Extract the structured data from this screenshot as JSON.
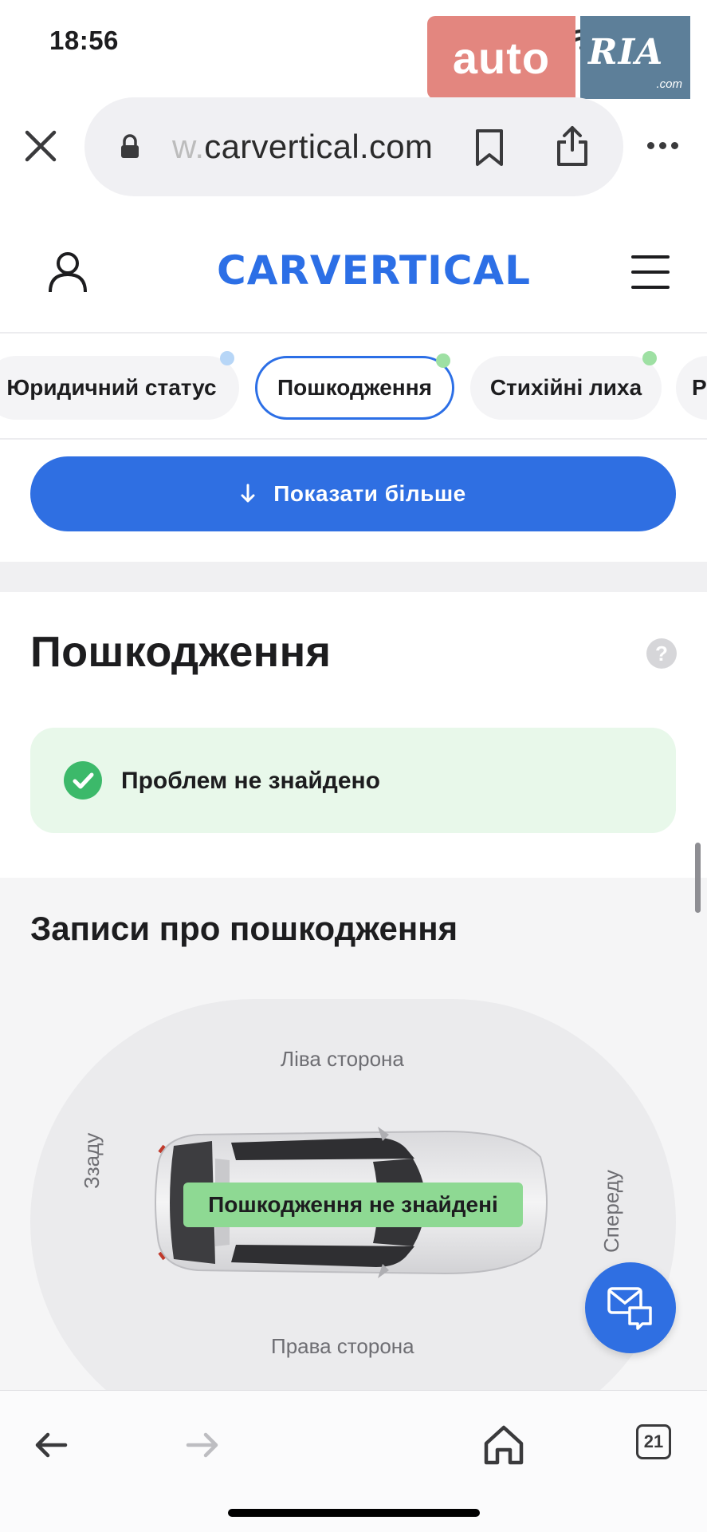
{
  "status": {
    "time": "18:56"
  },
  "watermark": {
    "auto": "auto",
    "ria": "RIA",
    "com": ".com"
  },
  "browser": {
    "url_faded": "w.",
    "url_main": "carvertical.com",
    "tabs_count": "21"
  },
  "header": {
    "logo": "CARVERTICAL"
  },
  "tabs": [
    {
      "label": "Юридичний статус",
      "dot": "#b7d6f7"
    },
    {
      "label": "Пошкодження",
      "dot": "#9ee0a3"
    },
    {
      "label": "Стихійні лиха",
      "dot": "#9ee0a3"
    },
    {
      "label": "Р",
      "dot": ""
    }
  ],
  "show_more": {
    "label": "Показати більше"
  },
  "damage": {
    "title": "Пошкодження",
    "help": "?",
    "status": "Проблем не знайдено"
  },
  "records": {
    "title": "Записи про пошкодження",
    "left_side": "Ліва сторона",
    "right_side": "Права сторона",
    "rear": "Ззаду",
    "front": "Спереду",
    "badge": "Пошкодження не знайдені"
  },
  "colors": {
    "accent": "#2f6fe2",
    "success": "#3cb96a",
    "success_bg": "#e8f8ea"
  }
}
